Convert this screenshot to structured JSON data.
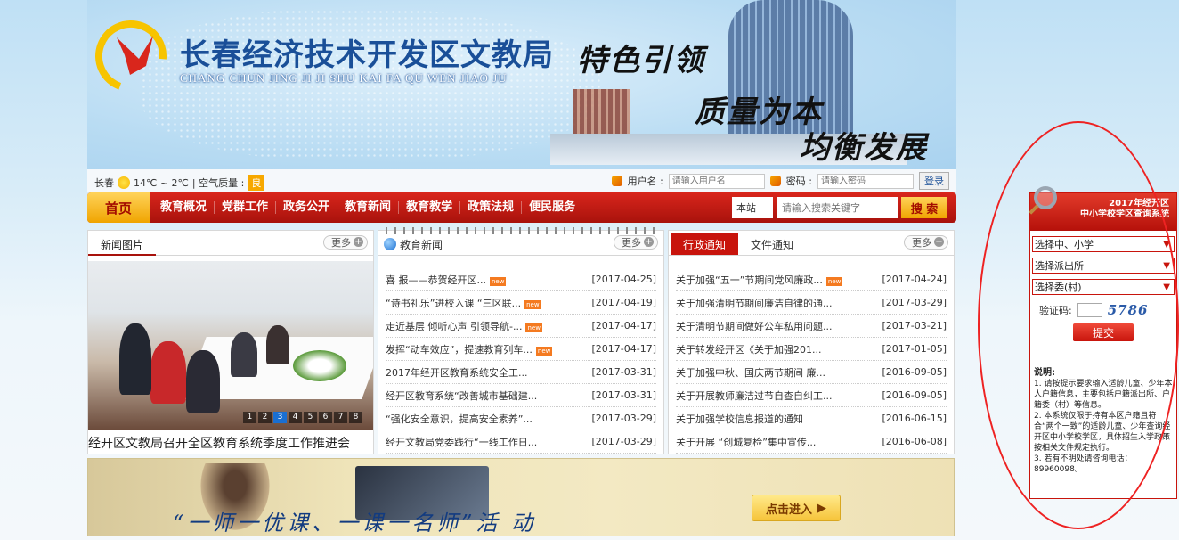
{
  "header": {
    "site_title": "长春经济技术开发区文教局",
    "site_subtitle": "CHANG CHUN JING JI JI SHU KAI FA QU WEN JIAO JU",
    "slogans": [
      "特色引领",
      "质量为本",
      "均衡发展"
    ]
  },
  "infobar": {
    "city": "长春",
    "temperature": "14℃ ~ 2℃",
    "air_quality_label": "| 空气质量 :",
    "air_quality_value": "良",
    "username_label": "用户名 :",
    "username_placeholder": "请输入用户名",
    "password_label": "密码 :",
    "password_placeholder": "请输入密码",
    "login_button": "登录"
  },
  "nav": {
    "home": "首页",
    "items": [
      "教育概况",
      "党群工作",
      "政务公开",
      "教育新闻",
      "教育教学",
      "政策法规",
      "便民服务"
    ],
    "search_scope": "本站",
    "search_placeholder": "请输入搜索关键字",
    "search_button": "搜 索"
  },
  "panel_photo": {
    "tab": "新闻图片",
    "more": "更多",
    "pager": [
      "1",
      "2",
      "3",
      "4",
      "5",
      "6",
      "7",
      "8"
    ],
    "caption": "经开区文教局召开全区教育系统季度工作推进会"
  },
  "panel_news": {
    "tab": "教育新闻",
    "more": "更多",
    "new_badge": "new",
    "rows": [
      {
        "title": "喜 报——恭贺经开区...",
        "date": "[2017-04-25]",
        "new": true
      },
      {
        "title": "“诗书礼乐”进校入课 “三区联...",
        "date": "[2017-04-19]",
        "new": true
      },
      {
        "title": "走近基层 倾听心声 引领导航-...",
        "date": "[2017-04-17]",
        "new": true
      },
      {
        "title": "发挥“动车效应”，提速教育列车...",
        "date": "[2017-04-17]",
        "new": true
      },
      {
        "title": "2017年经开区教育系统安全工...",
        "date": "[2017-03-31]",
        "new": false
      },
      {
        "title": "经开区教育系统“改善城市基础建...",
        "date": "[2017-03-31]",
        "new": false
      },
      {
        "title": "“强化安全意识，提高安全素养”...",
        "date": "[2017-03-29]",
        "new": false
      },
      {
        "title": "经开文教局党委践行“一线工作日...",
        "date": "[2017-03-29]",
        "new": false
      }
    ]
  },
  "panel_notice": {
    "tab_active": "行政通知",
    "tab_other": "文件通知",
    "more": "更多",
    "rows": [
      {
        "title": "关于加强“五一”节期间党风廉政...",
        "date": "[2017-04-24]",
        "new": true
      },
      {
        "title": "关于加强清明节期间廉洁自律的通...",
        "date": "[2017-03-29]",
        "new": false
      },
      {
        "title": "关于清明节期间做好公车私用问题...",
        "date": "[2017-03-21]",
        "new": false
      },
      {
        "title": "关于转发经开区《关于加强201...",
        "date": "[2017-01-05]",
        "new": false
      },
      {
        "title": "关于加强中秋、国庆两节期间 廉...",
        "date": "[2016-09-05]",
        "new": false
      },
      {
        "title": "关于开展教师廉洁过节自查自纠工...",
        "date": "[2016-09-05]",
        "new": false
      },
      {
        "title": "关于加强学校信息报道的通知",
        "date": "[2016-06-15]",
        "new": false
      },
      {
        "title": "关于开展 “创城复检”集中宣传...",
        "date": "[2016-06-08]",
        "new": false
      }
    ]
  },
  "banner": {
    "text": "“一师一优课、一课一名师”活 动",
    "enter_button": "点击进入"
  },
  "widget": {
    "title_line1": "2017年经开区",
    "title_line2": "中小学校学区查询系统",
    "select_school": "选择中、小学",
    "select_police": "选择派出所",
    "select_committee": "选择委(村)",
    "captcha_label": "验证码:",
    "captcha_code": "5786",
    "submit": "提交",
    "note_title": "说明:",
    "note_1": "1. 请按提示要求输入适龄儿童、少年本人户籍信息，主要包括户籍派出所、户籍委（村）等信息。",
    "note_2": "2. 本系统仅限于持有本区户籍且符合“两个一致”的适龄儿童、少年查询经开区中小学校学区，具体招生入学政策按相关文件规定执行。",
    "note_3": "3. 若有不明处请咨询电话：89960098。"
  },
  "colors": {
    "nav_red": "#c8140c",
    "title_blue": "#1a4f98",
    "accent_gold": "#f0a400"
  }
}
